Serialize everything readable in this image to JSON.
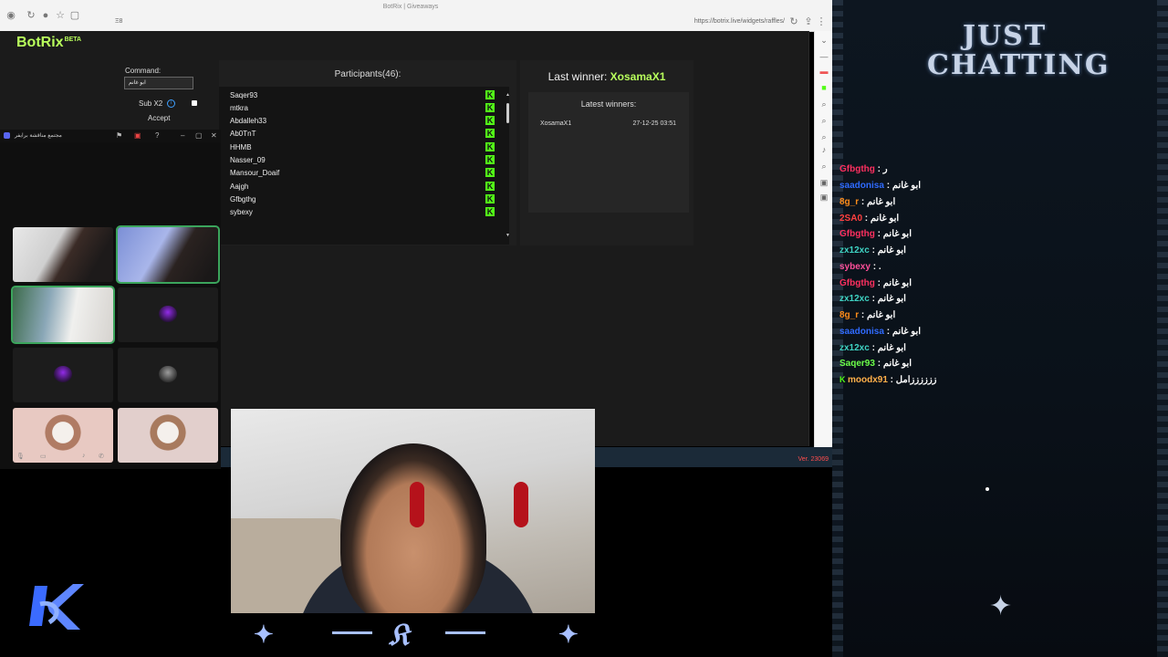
{
  "browser": {
    "tab_title": "BotRix | Giveaways",
    "address_short": "Ξ8",
    "url": "https://botrix.live/widgets/raffles/"
  },
  "botrix": {
    "logo": "BotRix",
    "logo_badge": "BETA",
    "command_label": "Command:",
    "command_value": "ابو غانم",
    "sub_label": "Sub X2",
    "sub_info": "i",
    "accept_label": "Accept",
    "participants_title": "Participants(46):",
    "participants": [
      "Saqer93",
      "mtkra",
      "Abdalleh33",
      "Ab0TnT",
      "HHMB",
      "Nasser_09",
      "Mansour_Doaif",
      "Aajgh",
      "Gfbgthg",
      "sybexy"
    ],
    "last_winner_label": "Last winner:",
    "last_winner_name": "XosamaX1",
    "latest_winners_title": "Latest winners:",
    "latest_winners": [
      {
        "name": "XosamaX1",
        "date": "27-12-25 03:51"
      }
    ],
    "version": "Ver. 23069"
  },
  "call": {
    "title": "مجتمع مناقشة برايفر"
  },
  "chat": {
    "category": "JUST CHATTING",
    "messages": [
      {
        "user": "Gfbgthg",
        "text": "ر",
        "color": "#ff3060"
      },
      {
        "user": "saadonisa",
        "text": "ابو غانم",
        "color": "#2f6bff"
      },
      {
        "user": "8g_r",
        "text": "ابو غانم",
        "color": "#ff8c1a"
      },
      {
        "user": "2SA0",
        "text": "ابو غانم",
        "color": "#ff4040"
      },
      {
        "user": "Gfbgthg",
        "text": "ابو غانم",
        "color": "#ff3060"
      },
      {
        "user": "zx12xc",
        "text": "ابو غانم",
        "color": "#3fd4c4"
      },
      {
        "user": "sybexy",
        "text": ".",
        "color": "#ff4f9a"
      },
      {
        "user": "Gfbgthg",
        "text": "ابو غانم",
        "color": "#ff3060"
      },
      {
        "user": "zx12xc",
        "text": "ابو غانم",
        "color": "#3fd4c4"
      },
      {
        "user": "8g_r",
        "text": "ابو غانم",
        "color": "#ff8c1a"
      },
      {
        "user": "saadonisa",
        "text": "ابو غانم",
        "color": "#2f6bff"
      },
      {
        "user": "zx12xc",
        "text": "ابو غانم",
        "color": "#3fd4c4"
      },
      {
        "user": "Saqer93",
        "text": "ابو غانم",
        "color": "#6cff4a"
      },
      {
        "user": "moodx91",
        "text": "ززززززامل",
        "color": "#ffb04a"
      }
    ]
  },
  "colors": {
    "accent_green": "#b8ff5c",
    "kick_green": "#53fc18",
    "version_red": "#ff4d4d"
  }
}
